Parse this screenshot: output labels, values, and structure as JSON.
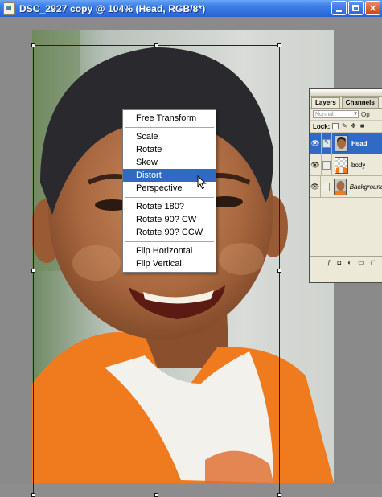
{
  "window": {
    "title": "DSC_2927 copy @ 104% (Head, RGB/8*)",
    "app_icon": "photoshop-document-icon",
    "buttons": [
      "minimize",
      "maximize",
      "close"
    ]
  },
  "context_menu": {
    "groups": [
      [
        "Free Transform"
      ],
      [
        "Scale",
        "Rotate",
        "Skew",
        "Distort",
        "Perspective"
      ],
      [
        "Rotate 180?",
        "Rotate 90? CW",
        "Rotate 90? CCW"
      ],
      [
        "Flip Horizontal",
        "Flip Vertical"
      ]
    ],
    "highlighted": "Distort"
  },
  "layers_panel": {
    "tabs": [
      "Layers",
      "Channels"
    ],
    "active_tab": "Layers",
    "blend_mode": "Normal",
    "opacity_label": "Op",
    "lock_label": "Lock:",
    "layers": [
      {
        "name": "Head",
        "selected": true,
        "visible": true
      },
      {
        "name": "body",
        "selected": false,
        "visible": true
      },
      {
        "name": "Background",
        "selected": false,
        "visible": true
      }
    ]
  },
  "colors": {
    "title_bar": "#2a64d3",
    "menu_highlight": "#316ac5",
    "panel_bg": "#ece9d8"
  }
}
